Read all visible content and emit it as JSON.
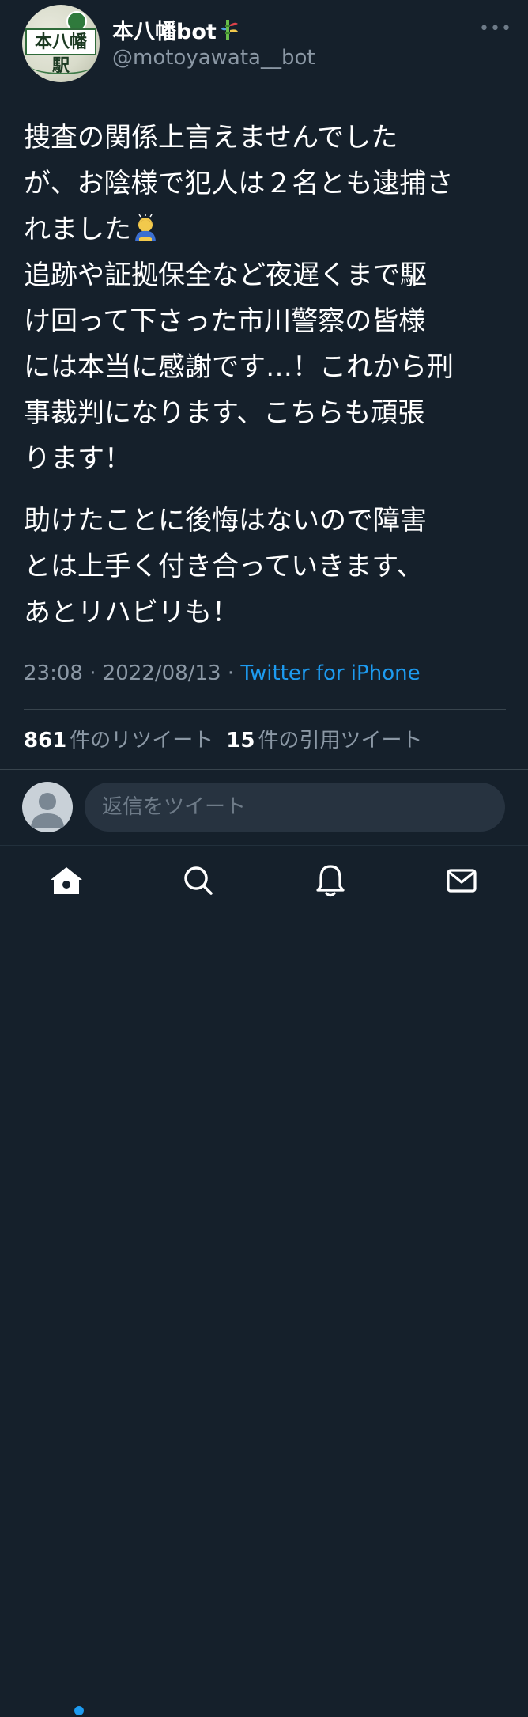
{
  "author": {
    "display_name": "本八幡bot",
    "handle": "@motoyawata__bot",
    "avatar_sign_text": "本八幡駅"
  },
  "tweet": {
    "paragraphs": [
      "捜査の関係上言えませんでした\nが、お陰様で犯人は２名とも逮捕さ\nれました",
      "助けたことに後悔はないので障害\nとは上手く付き合っていきます、\nあとリハビリも！"
    ],
    "paragraph1_after_emoji": "\n追跡や証拠保全など夜遅くまで駆\nけ回って下さった市川警察の皆様\nには本当に感謝です…！これから刑\n事裁判になります、こちらも頑張\nります！",
    "emoji": "bowing-person-emoji"
  },
  "meta": {
    "time": "23:08",
    "separator": " · ",
    "date": "2022/08/13",
    "client": "Twitter for iPhone"
  },
  "stats": {
    "retweets_count": "861",
    "retweets_label": "件のリツイート",
    "quotes_count": "15",
    "quotes_label": "件の引用ツイート"
  },
  "reply": {
    "placeholder": "返信をツイート"
  },
  "tabbar": {
    "items": [
      "home-icon",
      "search-icon",
      "notifications-icon",
      "messages-icon"
    ],
    "accent": "#1d9bf0"
  },
  "colors": {
    "background": "#15202b",
    "text": "#ffffff",
    "secondary": "#8b98a5",
    "link": "#1d9bf0",
    "divider": "#38444d"
  }
}
